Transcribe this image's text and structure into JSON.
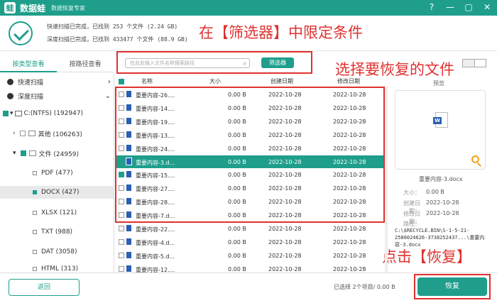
{
  "app": {
    "name": "数据蛙",
    "subtitle": "数据恢复专家"
  },
  "window_buttons": {
    "help": "?",
    "minimize": "—",
    "restore": "▢",
    "close": "✕"
  },
  "scan": {
    "quick": "快速扫描已完成，已找到  253 个文件 (2.24 GB)",
    "deep": "深度扫描已完成，已找到 433477 个文件 (88.9 GB)"
  },
  "annotations": {
    "filter": "在【筛选器】中限定条件",
    "select": "选择要恢复的文件",
    "recover": "点击【恢复】"
  },
  "tabs": [
    "按类型查看",
    "按路径查看"
  ],
  "sidebar": [
    {
      "label": "快速扫描"
    },
    {
      "label": "深度扫描"
    },
    {
      "label": "C:(NTFS) (192947)"
    },
    {
      "label": "其他 (106263)"
    },
    {
      "label": "文件 (24959)"
    },
    {
      "label": "PDF (477)"
    },
    {
      "label": "DOCX (427)"
    },
    {
      "label": "XLSX (121)"
    },
    {
      "label": "TXT (988)"
    },
    {
      "label": "DAT (3058)"
    },
    {
      "label": "HTML (313)"
    }
  ],
  "search": {
    "placeholder": "在此处输入文件名称搜索路径"
  },
  "filter_label": "筛选器",
  "columns": [
    "名称",
    "大小",
    "创建日期",
    "修改日期"
  ],
  "files": [
    {
      "name": "重要内容-26....",
      "size": "0.00  B",
      "created": "2022-10-28",
      "modified": "2022-10-28"
    },
    {
      "name": "重要内容-14....",
      "size": "0.00  B",
      "created": "2022-10-28",
      "modified": "2022-10-28"
    },
    {
      "name": "重要内容-19....",
      "size": "0.00  B",
      "created": "2022-10-28",
      "modified": "2022-10-28"
    },
    {
      "name": "重要内容-13....",
      "size": "0.00  B",
      "created": "2022-10-28",
      "modified": "2022-10-28"
    },
    {
      "name": "重要内容-24....",
      "size": "0.00  B",
      "created": "2022-10-28",
      "modified": "2022-10-28"
    },
    {
      "name": "重要内容-3.d...",
      "size": "0.00  B",
      "created": "2022-10-28",
      "modified": "2022-10-28"
    },
    {
      "name": "重要内容-15....",
      "size": "0.00  B",
      "created": "2022-10-28",
      "modified": "2022-10-28"
    },
    {
      "name": "重要内容-27....",
      "size": "0.00  B",
      "created": "2022-10-28",
      "modified": "2022-10-28"
    },
    {
      "name": "重要内容-28....",
      "size": "0.00  B",
      "created": "2022-10-28",
      "modified": "2022-10-28"
    },
    {
      "name": "重要内容-7.d...",
      "size": "0.00  B",
      "created": "2022-10-28",
      "modified": "2022-10-28"
    },
    {
      "name": "重要内容-22....",
      "size": "0.00  B",
      "created": "2022-10-28",
      "modified": "2022-10-28"
    },
    {
      "name": "重要内容-4.d...",
      "size": "0.00  B",
      "created": "2022-10-28",
      "modified": "2022-10-28"
    },
    {
      "name": "重要内容-5.d...",
      "size": "0.00  B",
      "created": "2022-10-28",
      "modified": "2022-10-28"
    },
    {
      "name": "重要内容-12....",
      "size": "0.00  B",
      "created": "2022-10-28",
      "modified": "2022-10-28"
    }
  ],
  "preview": {
    "title": "预览",
    "icon_letter": "W",
    "filename": "重要内容-3.docx",
    "size_label": "大小：",
    "size": "0.00  B",
    "created_label": "创建日期：",
    "created": "2022-10-28",
    "modified_label": "修改日期：",
    "modified": "2022-10-28",
    "path_label": "路径：",
    "path": "C:\\$RECYCLE.BIN\\S-1-5-21-2580024626-3738252437...\\重要内容-3.docx"
  },
  "footer": {
    "back": "返回",
    "selection": "已选择 2个项目/ 0.00  B",
    "recover": "恢复"
  },
  "colors": {
    "accent": "#1f9e8c",
    "annotation": "#e03131"
  }
}
